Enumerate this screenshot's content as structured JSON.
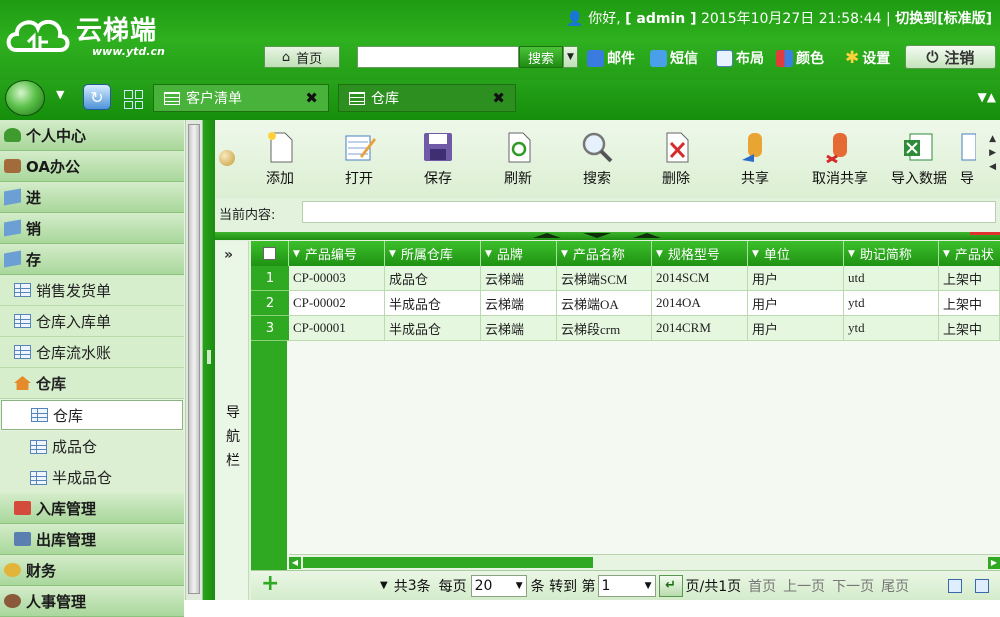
{
  "app": {
    "logo_text": "云梯端",
    "logo_url": "www.ytd.cn"
  },
  "header": {
    "greeting": "你好,",
    "username": "admin",
    "date": "2015年10月27日",
    "time": "21:58:44",
    "switch_label": "切换到[标准版]",
    "home_label": "首页",
    "search_value": "",
    "search_button": "搜索",
    "links": {
      "mail": "邮件",
      "sms": "短信",
      "layout": "布局",
      "color": "颜色",
      "settings": "设置"
    },
    "logout_label": "注销"
  },
  "tabs": [
    {
      "label": "客户清单",
      "active": false
    },
    {
      "label": "仓库",
      "active": true
    }
  ],
  "sidebar": {
    "items": [
      {
        "label": "个人中心",
        "level": "header"
      },
      {
        "label": "OA办公",
        "level": "header"
      },
      {
        "label": "进",
        "level": "header"
      },
      {
        "label": "销",
        "level": "header"
      },
      {
        "label": "存",
        "level": "header"
      },
      {
        "label": "销售发货单",
        "level": "sub"
      },
      {
        "label": "仓库入库单",
        "level": "sub"
      },
      {
        "label": "仓库流水账",
        "level": "sub"
      },
      {
        "label": "仓库",
        "level": "subheader"
      },
      {
        "label": "仓库",
        "level": "sub2",
        "selected": true
      },
      {
        "label": "成品仓",
        "level": "sub2"
      },
      {
        "label": "半成品仓",
        "level": "sub2"
      },
      {
        "label": "入库管理",
        "level": "header"
      },
      {
        "label": "出库管理",
        "level": "header"
      },
      {
        "label": "财务",
        "level": "header"
      },
      {
        "label": "人事管理",
        "level": "header"
      }
    ]
  },
  "toolbar": {
    "buttons": [
      {
        "label": "添加",
        "icon": "add-document-icon"
      },
      {
        "label": "打开",
        "icon": "open-edit-icon"
      },
      {
        "label": "保存",
        "icon": "save-disk-icon"
      },
      {
        "label": "刷新",
        "icon": "refresh-icon"
      },
      {
        "label": "搜索",
        "icon": "magnifier-icon"
      },
      {
        "label": "删除",
        "icon": "delete-document-icon"
      },
      {
        "label": "共享",
        "icon": "share-user-icon"
      },
      {
        "label": "取消共享",
        "icon": "unshare-user-icon"
      },
      {
        "label": "导入数据",
        "icon": "excel-import-icon"
      },
      {
        "label": "导",
        "icon": "export-icon"
      }
    ],
    "current_content_label": "当前内容:",
    "current_content_value": ""
  },
  "nav_strip_label": "导航栏",
  "grid": {
    "columns": [
      "产品编号",
      "所属仓库",
      "品牌",
      "产品名称",
      "规格型号",
      "单位",
      "助记简称",
      "产品状"
    ],
    "rows": [
      {
        "num": "1",
        "cells": [
          "CP-00003",
          "成品仓",
          "云梯端",
          "云梯端SCM",
          "2014SCM",
          "用户",
          "utd",
          "上架中"
        ]
      },
      {
        "num": "2",
        "cells": [
          "CP-00002",
          "半成品仓",
          "云梯端",
          "云梯端OA",
          "2014OA",
          "用户",
          "ytd",
          "上架中"
        ]
      },
      {
        "num": "3",
        "cells": [
          "CP-00001",
          "半成品仓",
          "云梯端",
          "云梯段crm",
          "2014CRM",
          "用户",
          "ytd",
          "上架中"
        ]
      }
    ]
  },
  "pager": {
    "total_prefix": "共",
    "total": "3",
    "total_suffix": "条",
    "per_page_label": "每页",
    "per_page_value": "20",
    "goto_label": "条 转到 第",
    "page_value": "1",
    "page_info": "页/共1页",
    "first": "首页",
    "prev": "上一页",
    "next": "下一页",
    "last": "尾页"
  },
  "colors": {
    "header_green": "#2eb01f",
    "sidebar_bg": "#e8f3e3",
    "grid_green": "#2fa822"
  }
}
